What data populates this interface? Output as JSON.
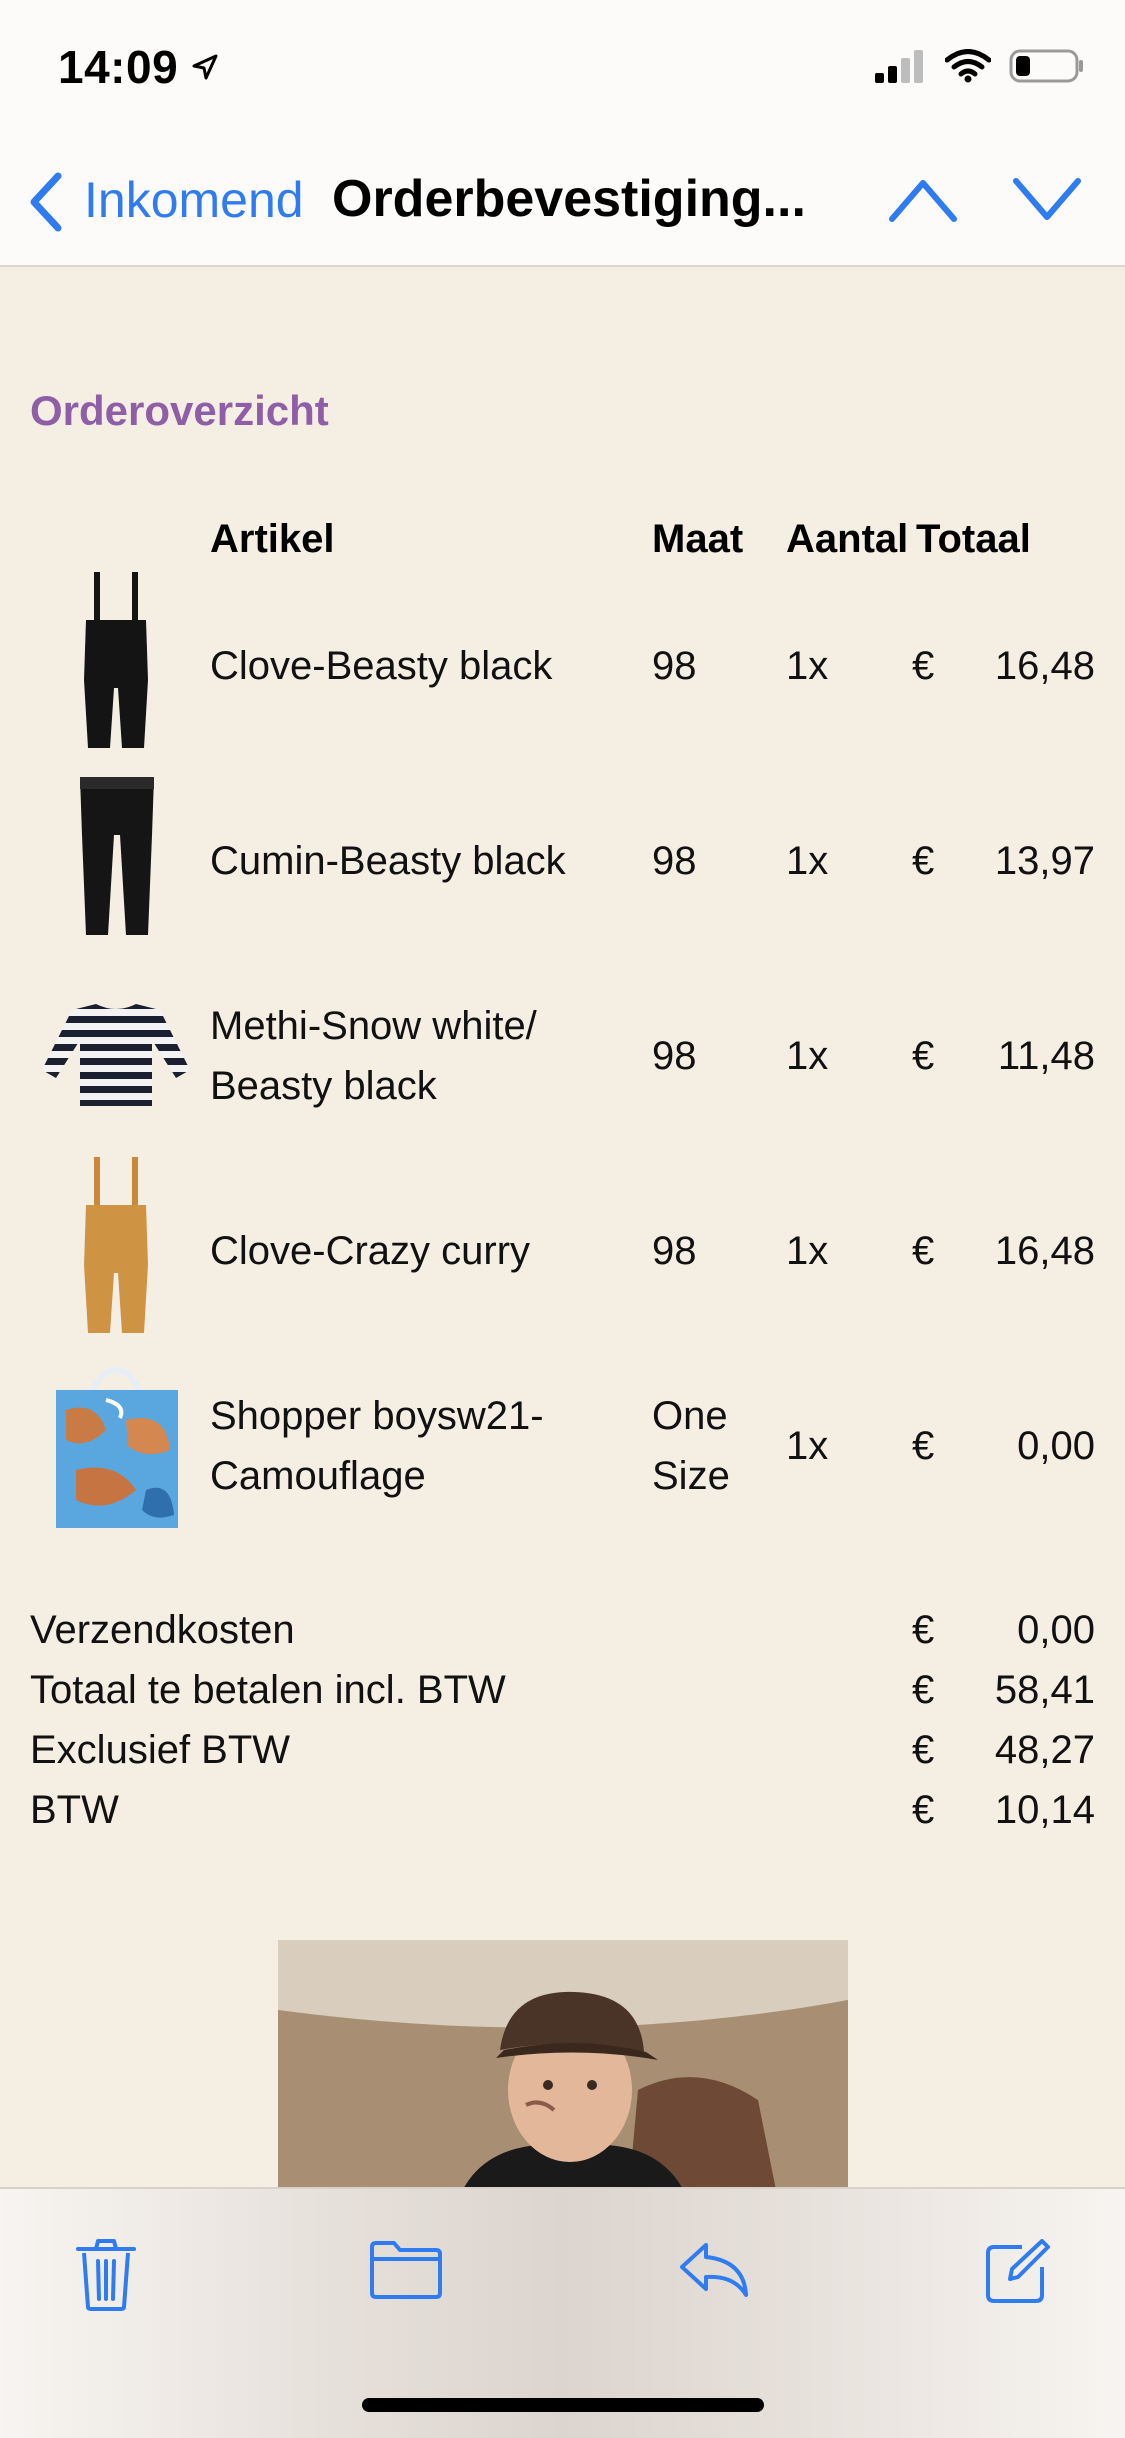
{
  "status_bar": {
    "time": "14:09"
  },
  "nav": {
    "back_label": "Inkomend",
    "title": "Orderbevestiging..."
  },
  "order": {
    "section_title": "Orderoverzicht",
    "headers": {
      "article": "Artikel",
      "size": "Maat",
      "qty": "Aantal",
      "total": "Totaal"
    },
    "items": [
      {
        "name": "Clove-Beasty black",
        "size": "98",
        "qty": "1x",
        "currency": "€",
        "amount": "16,48",
        "image": "black-overalls"
      },
      {
        "name": "Cumin-Beasty black",
        "size": "98",
        "qty": "1x",
        "currency": "€",
        "amount": "13,97",
        "image": "black-pants"
      },
      {
        "name": "Methi-Snow white/ Beasty black",
        "size": "98",
        "qty": "1x",
        "currency": "€",
        "amount": "11,48",
        "image": "striped-shirt"
      },
      {
        "name": "Clove-Crazy curry",
        "size": "98",
        "qty": "1x",
        "currency": "€",
        "amount": "16,48",
        "image": "curry-overalls"
      },
      {
        "name": "Shopper boysw21- Camouflage",
        "size": "One Size",
        "qty": "1x",
        "currency": "€",
        "amount": "0,00",
        "image": "camouflage-shopper-bag"
      }
    ],
    "summary": [
      {
        "label": "Verzendkosten",
        "currency": "€",
        "amount": "0,00"
      },
      {
        "label": "Totaal te betalen incl. BTW",
        "currency": "€",
        "amount": "58,41"
      },
      {
        "label": "Exclusief BTW",
        "currency": "€",
        "amount": "48,27"
      },
      {
        "label": "BTW",
        "currency": "€",
        "amount": "10,14"
      }
    ]
  },
  "toolbar": {
    "icons": [
      "trash-icon",
      "folder-icon",
      "reply-icon",
      "compose-icon"
    ]
  },
  "colors": {
    "accent": "#2f7bf2",
    "section_title": "#8e5fa6",
    "background": "#f5eee3"
  }
}
